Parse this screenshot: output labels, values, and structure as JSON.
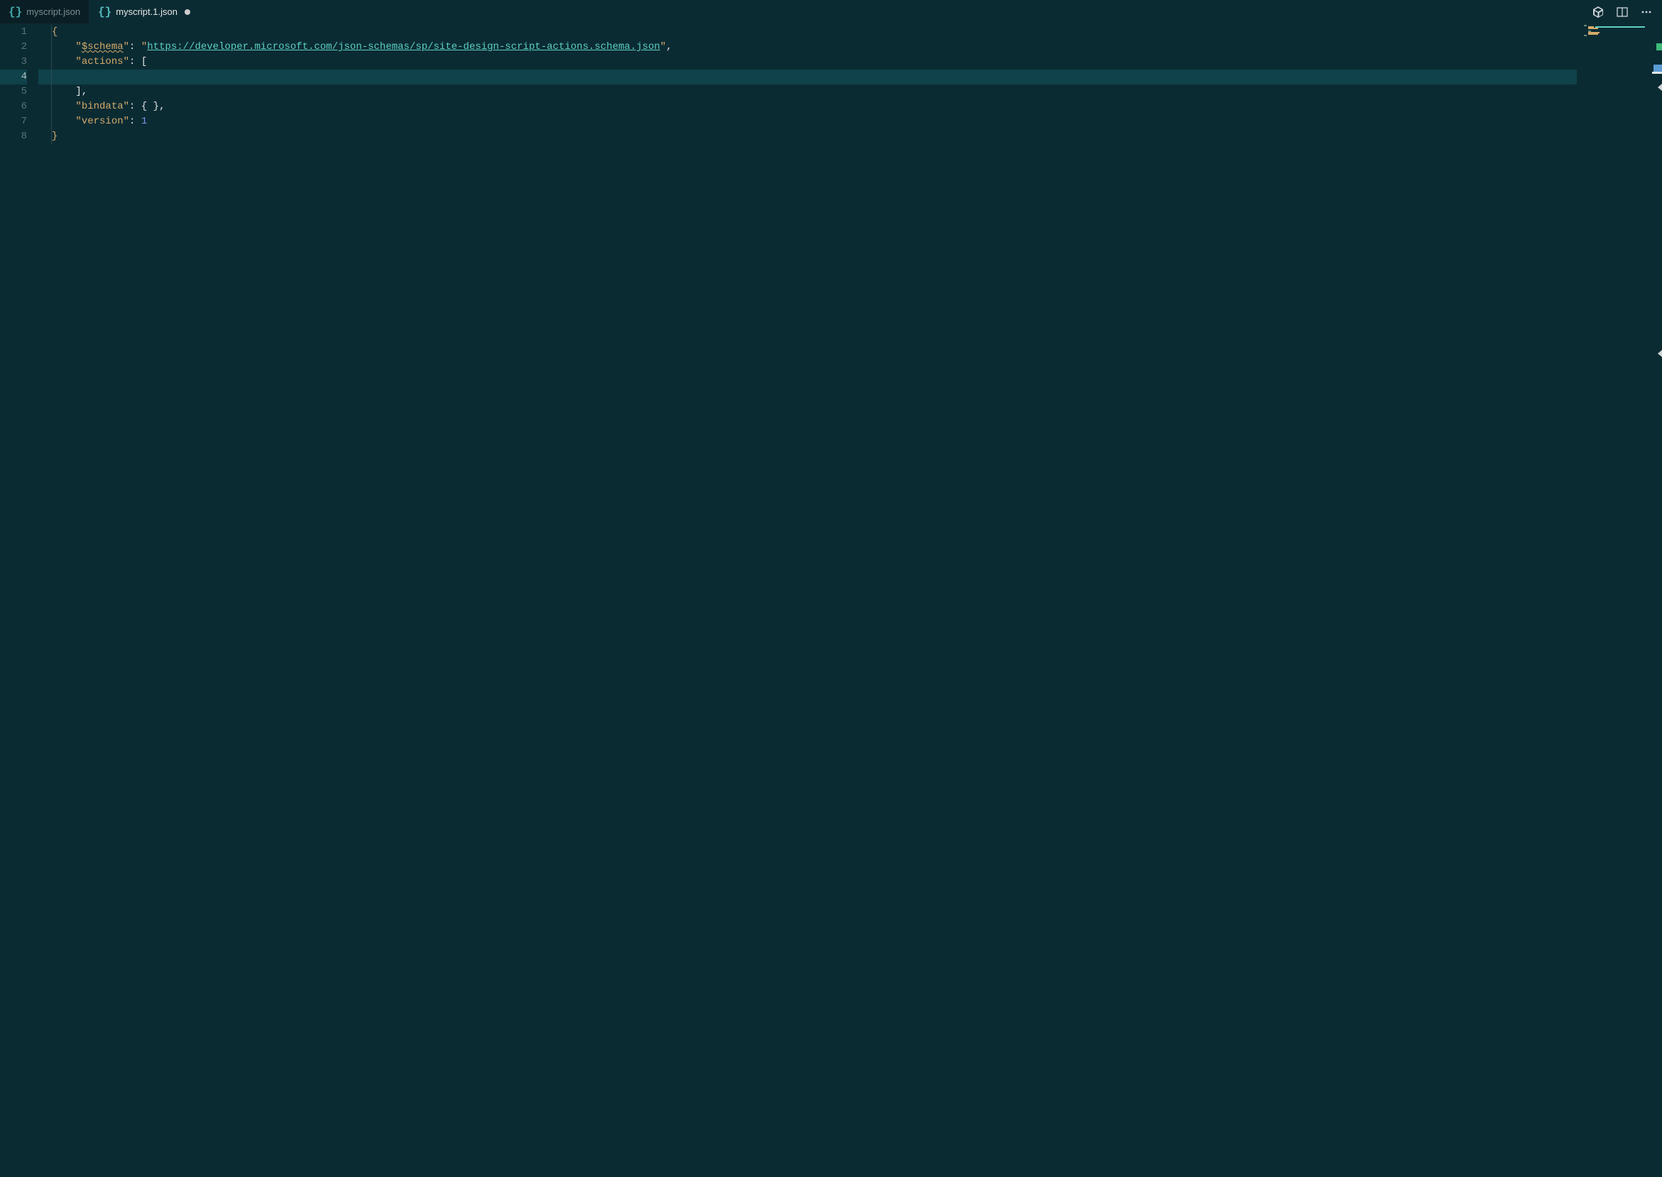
{
  "tabs": [
    {
      "name": "myscript.json",
      "active": false,
      "modified": false
    },
    {
      "name": "myscript.1.json",
      "active": true,
      "modified": true
    }
  ],
  "gutter": {
    "lines": [
      "1",
      "2",
      "3",
      "4",
      "5",
      "6",
      "7",
      "8"
    ]
  },
  "code": {
    "line1": {
      "brace": "{"
    },
    "line2": {
      "quote": "\"",
      "key": "$schema",
      "colon": ": ",
      "url": "https://developer.microsoft.com/json-schemas/sp/site-design-script-actions.schema.json",
      "comma": ","
    },
    "line3": {
      "quote": "\"",
      "key": "actions",
      "colon": ": ",
      "bracket": "["
    },
    "line4": {
      "empty": ""
    },
    "line5": {
      "bracket": "]",
      "comma": ","
    },
    "line6": {
      "quote": "\"",
      "key": "bindata",
      "colon": ": ",
      "obj": "{ }",
      "comma": ","
    },
    "line7": {
      "quote": "\"",
      "key": "version",
      "colon": ": ",
      "value": "1"
    },
    "line8": {
      "brace": "}"
    }
  }
}
